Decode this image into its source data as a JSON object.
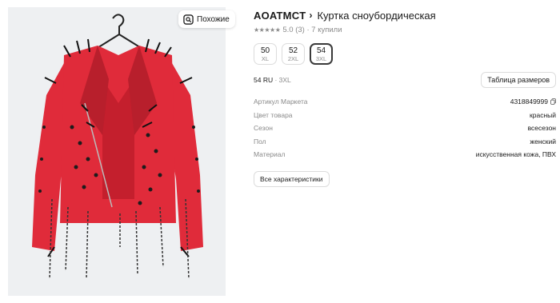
{
  "similar_button": {
    "label": "Похожие"
  },
  "product": {
    "brand": "AOATMCT",
    "title": "Куртка сноубордическая",
    "rating": "5.0",
    "reviews": "(3)",
    "purchases": "· 7 купили"
  },
  "sizes": [
    {
      "value": "50",
      "label": "XL",
      "selected": false
    },
    {
      "value": "52",
      "label": "2XL",
      "selected": false
    },
    {
      "value": "54",
      "label": "3XL",
      "selected": true
    }
  ],
  "selected_size": {
    "ru": "54 RU",
    "intl": "· 3XL"
  },
  "size_table_button": "Таблица размеров",
  "specs": [
    {
      "key": "Артикул Маркета",
      "value": "4318849999"
    },
    {
      "key": "Цвет товара",
      "value": "красный"
    },
    {
      "key": "Сезон",
      "value": "всесезон"
    },
    {
      "key": "Пол",
      "value": "женский"
    },
    {
      "key": "Материал",
      "value": "искусственная кожа, ПВХ"
    }
  ],
  "all_specs_button": "Все характеристики",
  "colors": {
    "jacket": "#e02b3a",
    "jacket_dark": "#a81826",
    "photo_bg": "#eef0f2"
  }
}
